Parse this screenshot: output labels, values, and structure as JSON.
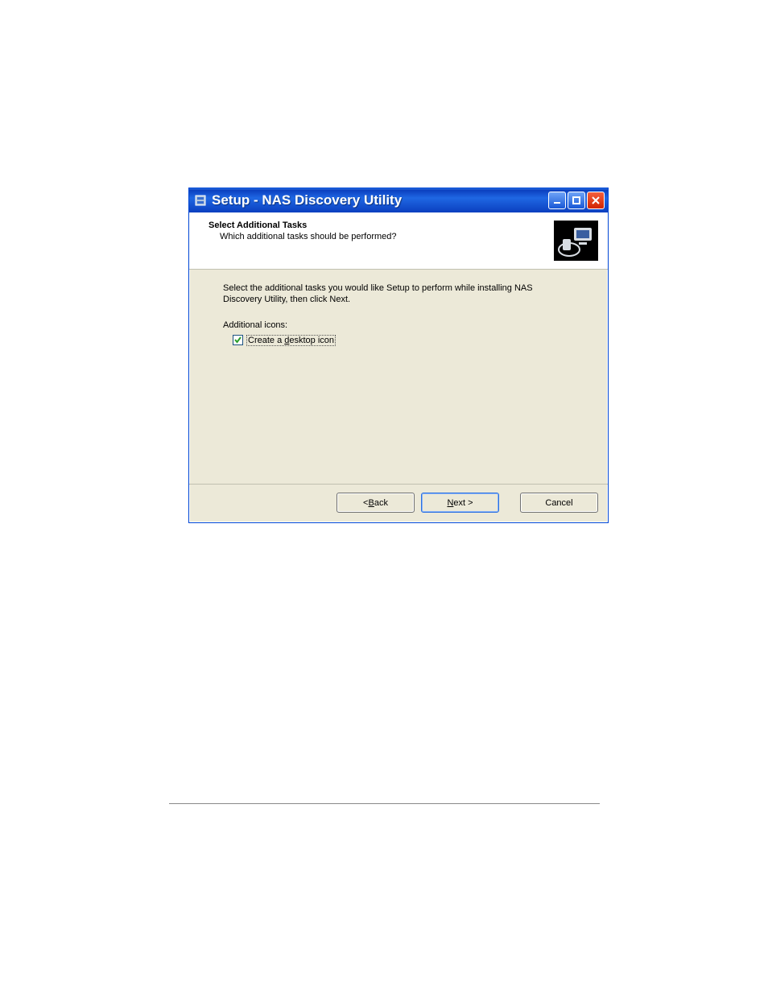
{
  "window": {
    "title": "Setup - NAS Discovery Utility"
  },
  "header": {
    "title": "Select Additional Tasks",
    "subtitle": "Which additional tasks should be performed?"
  },
  "body": {
    "instruction": "Select the additional tasks you would like Setup to perform while installing NAS Discovery Utility, then click Next.",
    "section_label": "Additional icons:",
    "checkbox_label_pre": "Create a ",
    "checkbox_label_u": "d",
    "checkbox_label_post": "esktop icon",
    "checkbox_checked": true
  },
  "footer": {
    "back_pre": "< ",
    "back_u": "B",
    "back_post": "ack",
    "next_u": "N",
    "next_post": "ext >",
    "cancel": "Cancel"
  }
}
